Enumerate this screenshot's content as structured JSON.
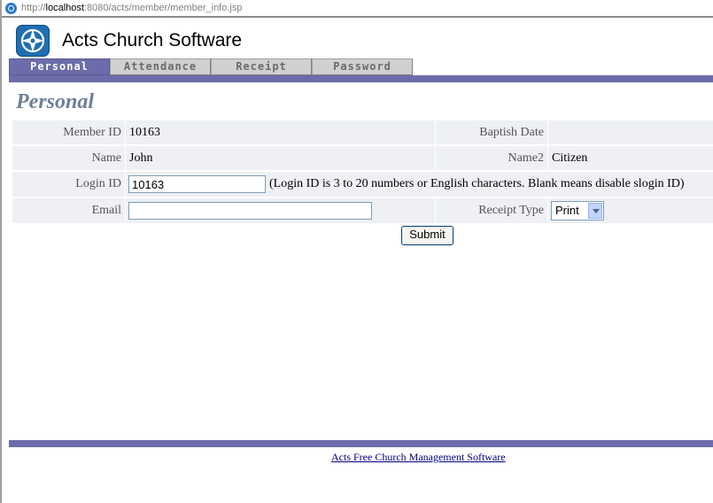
{
  "browser": {
    "url_prefix": "http://",
    "url_host": "localhost",
    "url_rest": ":8080/acts/member/member_info.jsp"
  },
  "app": {
    "title": "Acts Church Software",
    "logo_icon": "compass-star-icon",
    "accent_color": "#6c6caa"
  },
  "tabs": [
    {
      "label": "Personal",
      "active": true
    },
    {
      "label": "Attendance",
      "active": false
    },
    {
      "label": "Receipt",
      "active": false
    },
    {
      "label": "Password",
      "active": false
    }
  ],
  "section": {
    "title": "Personal"
  },
  "form": {
    "member_id": {
      "label": "Member ID",
      "value": "10163"
    },
    "baptism_date": {
      "label": "Baptish Date",
      "value": ""
    },
    "name": {
      "label": "Name",
      "value": "John"
    },
    "name2": {
      "label": "Name2",
      "value": "Citizen"
    },
    "login_id": {
      "label": "Login ID",
      "value": "10163",
      "hint": "(Login ID is 3 to 20 numbers or English characters. Blank means disable slogin ID)"
    },
    "email": {
      "label": "Email",
      "value": ""
    },
    "receipt_type": {
      "label": "Receipt Type",
      "selected": "Print"
    },
    "submit_label": "Submit"
  },
  "footer": {
    "link_text": "Acts Free Church Management Software"
  }
}
